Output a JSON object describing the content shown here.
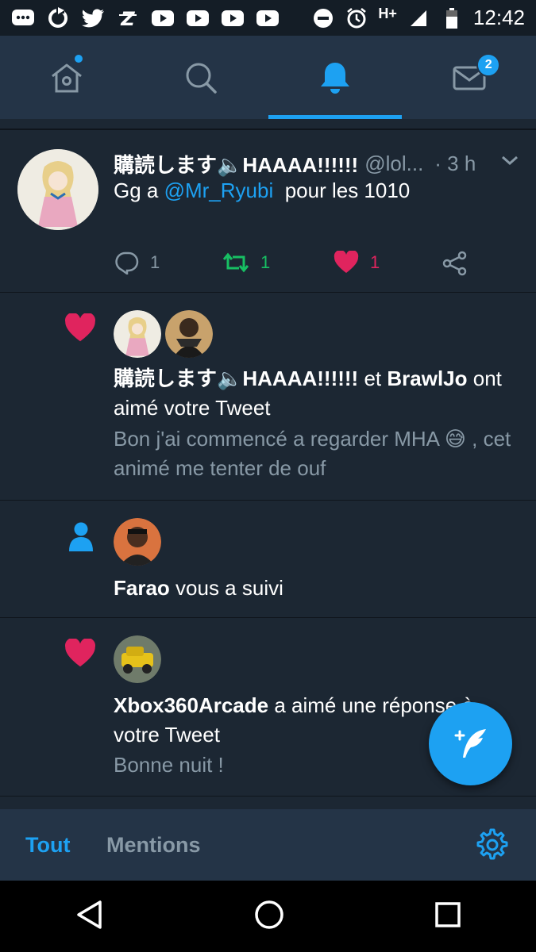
{
  "status_bar": {
    "time": "12:42",
    "network": "H+",
    "icons": [
      "messages-icon",
      "sync-icon",
      "twitter-icon",
      "z-app-icon",
      "youtube-icon",
      "youtube-icon",
      "youtube-icon",
      "youtube-icon",
      "dnd-icon",
      "alarm-icon",
      "signal-icon",
      "battery-icon"
    ]
  },
  "top_nav": {
    "tabs": [
      {
        "name": "home",
        "icon": "home-icon",
        "has_dot": true
      },
      {
        "name": "search",
        "icon": "search-icon"
      },
      {
        "name": "notifications",
        "icon": "bell-icon",
        "active": true
      },
      {
        "name": "messages",
        "icon": "mail-icon",
        "badge": "2"
      }
    ]
  },
  "tweet": {
    "display_name": "購読します🔈HAAAA!!!!!!",
    "handle": "@lol...",
    "time": "· 3 h",
    "text_prefix": "Gg a ",
    "mention": "@Mr_Ryubi",
    "text_suffix": "  pour les 1010",
    "replies": "1",
    "retweets": "1",
    "likes": "1",
    "colors": {
      "retweet": "#17bf63",
      "like": "#e0245e"
    }
  },
  "notifications": [
    {
      "type": "like",
      "icon": "heart-icon",
      "actor1": "購読します🔈HAAAA!!!!!!",
      "joiner": " et ",
      "actor2": "BrawlJo",
      "action": " ont aimé votre Tweet",
      "excerpt": "Bon j'ai commencé a regarder MHA 😅 , cet animé me tenter de ouf"
    },
    {
      "type": "follow",
      "icon": "person-icon",
      "actor": "Farao",
      "action": " vous a suivi"
    },
    {
      "type": "like",
      "icon": "heart-icon",
      "actor": "Xbox360Arcade",
      "action": " a aimé une réponse à votre Tweet",
      "excerpt": "Bonne nuit !"
    }
  ],
  "filter_bar": {
    "all": "Tout",
    "mentions": "Mentions",
    "settings_icon": "gear-icon"
  },
  "compose_icon": "compose-tweet-icon",
  "android_nav": [
    "back-icon",
    "home-circle-icon",
    "recents-icon"
  ]
}
